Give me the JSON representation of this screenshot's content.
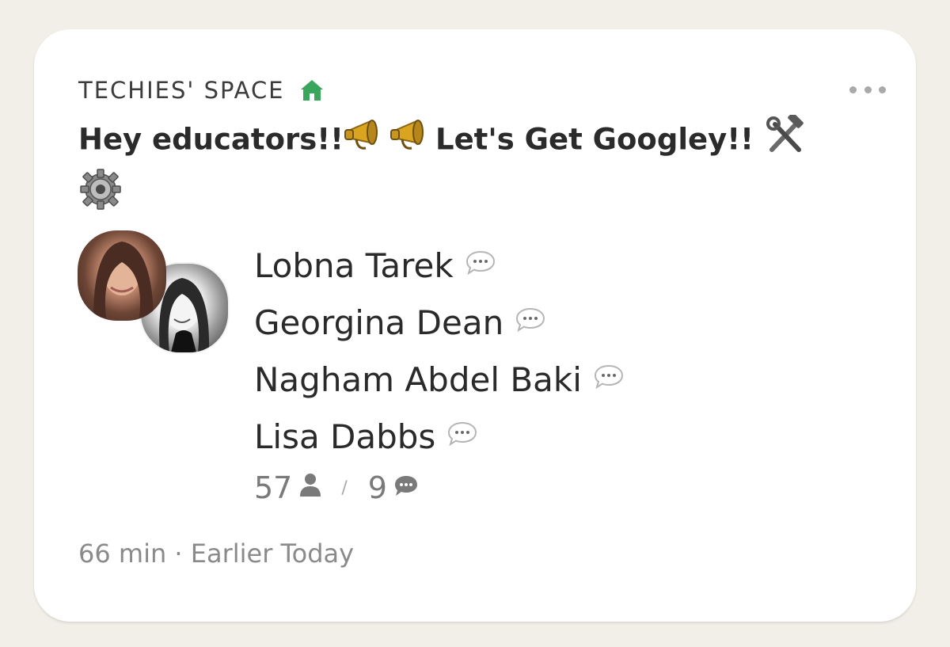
{
  "room": {
    "club_name": "TECHIES' SPACE",
    "club_icon": "house-icon",
    "title_text_1": "Hey educators!!",
    "title_text_2": "Let's Get Googley!!",
    "title_emojis": [
      "megaphone-icon",
      "megaphone-icon",
      "hammer-wrench-icon",
      "gear-icon"
    ],
    "more_icon": "more-dots-icon"
  },
  "speakers": [
    {
      "name": "Lobna Tarek",
      "icon": "speech-bubble-icon"
    },
    {
      "name": "Georgina Dean",
      "icon": "speech-bubble-icon"
    },
    {
      "name": "Nagham Abdel Baki",
      "icon": "speech-bubble-icon"
    },
    {
      "name": "Lisa Dabbs",
      "icon": "speech-bubble-icon"
    }
  ],
  "stats": {
    "listeners": "57",
    "speakers": "9",
    "separator": "/"
  },
  "footer": {
    "time": "66 min · Earlier Today"
  },
  "colors": {
    "background": "#f1efe8",
    "card": "#ffffff",
    "house_green": "#3aa55c",
    "text_dark": "#2b2b2b",
    "text_muted": "#8a8a8a"
  }
}
